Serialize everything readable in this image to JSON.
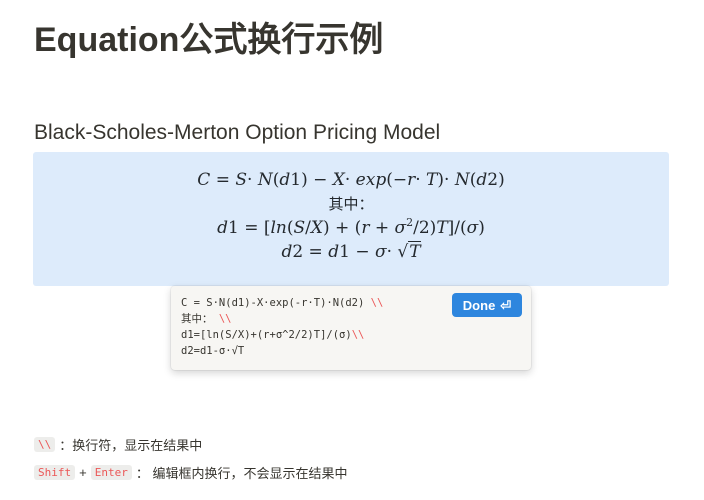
{
  "page": {
    "title": "Equation公式换行示例",
    "section_heading": "Black-Scholes-Merton Option Pricing Model"
  },
  "equation_rendered": {
    "line1": "C = S· N(d1) − X· exp(−r· T)· N(d2)",
    "line2": "其中：",
    "line3": "d1 = [ln(S/X) + (r + σ²/2)T]/(σ)",
    "line4": "d2 = d1 − σ· √T"
  },
  "editor": {
    "lines": [
      {
        "text": "C = S·N(d1)-X·exp(-r·T)·N(d2)",
        "break": "\\\\"
      },
      {
        "text": "其中：",
        "break": "\\\\"
      },
      {
        "text": "d1=[ln(S/X)+(r+σ^2/2)T]/(σ)",
        "break": "\\\\"
      },
      {
        "text": "d2=d1-σ·√T",
        "break": ""
      }
    ],
    "done_label": "Done",
    "done_icon": "enter-return-icon"
  },
  "hints": {
    "line_break_key": "\\\\",
    "line_break_desc": "：换行符，显示在结果中",
    "shift_key": "Shift",
    "plus": "+",
    "enter_key": "Enter",
    "shift_enter_desc": "：  编辑框内换行，不会显示在结果中"
  },
  "colors": {
    "equation_bg": "#ddebfb",
    "done_button": "#2e86de",
    "code_accent": "#eb5757"
  }
}
